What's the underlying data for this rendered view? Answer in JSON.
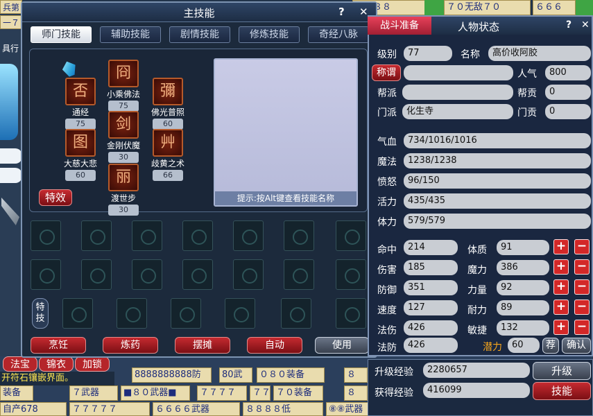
{
  "background": {
    "top_strips": [
      "武８８８",
      "７０无敌７０",
      "６６６"
    ],
    "left_frag": [
      "兵第",
      "一７",
      "具行"
    ],
    "bottom_row1": [
      "8888888888防",
      "80武",
      "０８０装备"
    ],
    "bottom_row2": [
      "７武器",
      "■８０武器■",
      "７７７７",
      "７７７７",
      "７０装备"
    ],
    "bottom_row3": [
      "自产678",
      "７７７７７",
      "６６６６武器",
      "８８８８低",
      "⑧⑧武器"
    ],
    "bottom_left_chips": [
      "法宝",
      "锦衣",
      "加锁"
    ],
    "yellow_notice": "开符石镶嵌界面。",
    "misc": [
      "装备",
      "８",
      "８"
    ]
  },
  "skill_window": {
    "title": "主技能",
    "help": "?",
    "close": "✕",
    "tabs": [
      "师门技能",
      "辅助技能",
      "剧情技能",
      "修炼技能",
      "奇经八脉"
    ],
    "skills": [
      {
        "name": "通经",
        "level": "75",
        "glyph": "否"
      },
      {
        "name": "小乘佛法",
        "level": "75",
        "glyph": "冏"
      },
      {
        "name": "佛光普照",
        "level": "60",
        "glyph": "彌"
      },
      {
        "name": "大慈大悲",
        "level": "60",
        "glyph": "图"
      },
      {
        "name": "金刚伏魔",
        "level": "30",
        "glyph": "剑"
      },
      {
        "name": "歧黄之术",
        "level": "66",
        "glyph": "艸"
      },
      {
        "name": "渡世步",
        "level": "30",
        "glyph": "丽"
      }
    ],
    "effect_button": "特效",
    "preview_hint": "提示:按Alt键查看技能名称",
    "special_label": "特技",
    "buttons": [
      "烹饪",
      "炼药",
      "摆摊",
      "自动",
      "使用"
    ]
  },
  "status_panel": {
    "combat_prep": "战斗准备",
    "title": "人物状态",
    "help": "?",
    "close": "✕",
    "level_label": "级别",
    "level": "77",
    "name_label": "名称",
    "name": "高价收阿胶",
    "title_button": "称谓",
    "title_value": "",
    "popularity_label": "人气",
    "popularity": "800",
    "gang_label": "帮派",
    "gang": "",
    "gang_contrib_label": "帮贡",
    "gang_contrib": "0",
    "sect_label": "门派",
    "sect": "化生寺",
    "sect_contrib_label": "门贡",
    "sect_contrib": "0",
    "bars": [
      {
        "label": "气血",
        "value": "734/1016/1016"
      },
      {
        "label": "魔法",
        "value": "1238/1238"
      },
      {
        "label": "愤怒",
        "value": "96/150"
      },
      {
        "label": "活力",
        "value": "435/435"
      },
      {
        "label": "体力",
        "value": "579/579"
      }
    ],
    "attrs_left": [
      {
        "label": "命中",
        "value": "214"
      },
      {
        "label": "伤害",
        "value": "185"
      },
      {
        "label": "防御",
        "value": "351"
      },
      {
        "label": "速度",
        "value": "127"
      },
      {
        "label": "法伤",
        "value": "426"
      },
      {
        "label": "法防",
        "value": "426"
      }
    ],
    "attrs_right": [
      {
        "label": "体质",
        "value": "91"
      },
      {
        "label": "魔力",
        "value": "386"
      },
      {
        "label": "力量",
        "value": "92"
      },
      {
        "label": "耐力",
        "value": "89"
      },
      {
        "label": "敏捷",
        "value": "132"
      }
    ],
    "plus": "+",
    "minus": "−",
    "potential_label": "潜力",
    "potential": "60",
    "recommend_button": "荐",
    "confirm_button": "确认",
    "exp_up_label": "升级经验",
    "exp_up": "2280657",
    "upgrade_button": "升级",
    "exp_got_label": "获得经验",
    "exp_got": "416099",
    "skill_button": "技能"
  }
}
